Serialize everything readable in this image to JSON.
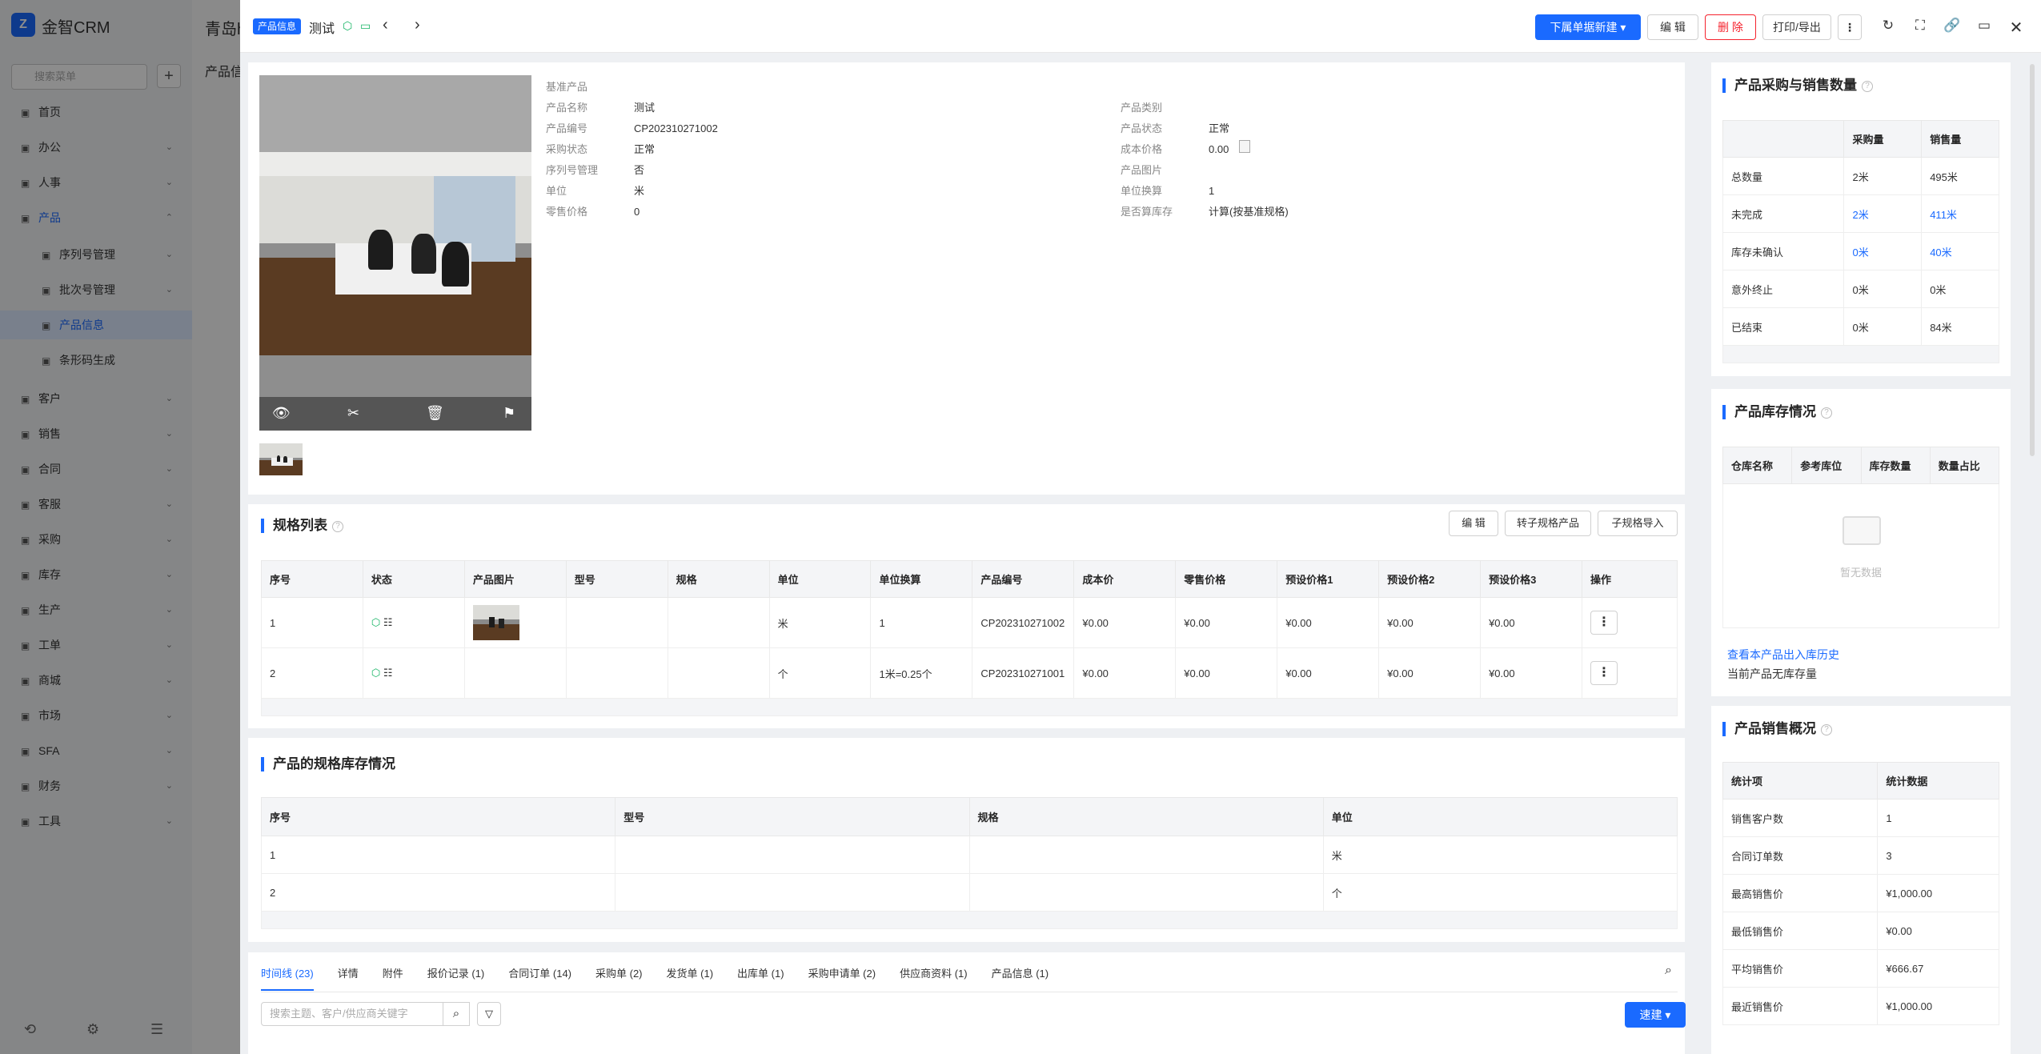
{
  "app": {
    "name": "金智CRM",
    "bg_title": "青岛h",
    "bg_sub": "产品信"
  },
  "sidebar": {
    "search_placeholder": "搜索菜单",
    "items": [
      {
        "label": "首页",
        "icon": "home-icon",
        "sub": false
      },
      {
        "label": "办公",
        "icon": "office-icon",
        "sub": false
      },
      {
        "label": "人事",
        "icon": "user-icon",
        "sub": false
      },
      {
        "label": "产品",
        "icon": "product-icon",
        "sub": false,
        "active": true
      },
      {
        "label": "序列号管理",
        "icon": "serial-icon",
        "sub": true
      },
      {
        "label": "批次号管理",
        "icon": "batch-icon",
        "sub": true
      },
      {
        "label": "产品信息",
        "icon": "product-info-icon",
        "sub": true,
        "active": true
      },
      {
        "label": "条形码生成",
        "icon": "barcode-icon",
        "sub": true
      },
      {
        "label": "客户",
        "icon": "customer-icon",
        "sub": false
      },
      {
        "label": "销售",
        "icon": "sales-icon",
        "sub": false
      },
      {
        "label": "合同",
        "icon": "contract-icon",
        "sub": false
      },
      {
        "label": "客服",
        "icon": "service-icon",
        "sub": false
      },
      {
        "label": "采购",
        "icon": "purchase-icon",
        "sub": false
      },
      {
        "label": "库存",
        "icon": "inventory-icon",
        "sub": false
      },
      {
        "label": "生产",
        "icon": "production-icon",
        "sub": false
      },
      {
        "label": "工单",
        "icon": "workorder-icon",
        "sub": false
      },
      {
        "label": "商城",
        "icon": "mall-icon",
        "sub": false
      },
      {
        "label": "市场",
        "icon": "market-icon",
        "sub": false
      },
      {
        "label": "SFA",
        "icon": "sfa-icon",
        "sub": false
      },
      {
        "label": "财务",
        "icon": "finance-icon",
        "sub": false
      },
      {
        "label": "工具",
        "icon": "tools-icon",
        "sub": false
      }
    ]
  },
  "header": {
    "tag": "产品信息",
    "title": "测试",
    "buttons": {
      "new_child": "下属单据新建",
      "edit": "编 辑",
      "delete": "删 除",
      "print": "打印/导出"
    }
  },
  "product": {
    "base_label": "基准产品",
    "left": [
      {
        "k": "产品名称",
        "v": "测试"
      },
      {
        "k": "产品编号",
        "v": "CP202310271002"
      },
      {
        "k": "采购状态",
        "v": "正常"
      },
      {
        "k": "序列号管理",
        "v": "否"
      },
      {
        "k": "单位",
        "v": "米"
      },
      {
        "k": "零售价格",
        "v": "0"
      }
    ],
    "right": [
      {
        "k": "产品类别",
        "v": ""
      },
      {
        "k": "产品状态",
        "v": "正常"
      },
      {
        "k": "成本价格",
        "v": "0.00"
      },
      {
        "k": "产品图片",
        "v": ""
      },
      {
        "k": "单位换算",
        "v": "1"
      },
      {
        "k": "是否算库存",
        "v": "计算(按基准规格)"
      }
    ]
  },
  "spec": {
    "title": "规格列表",
    "buttons": [
      "编 辑",
      "转子规格产品",
      "子规格导入"
    ],
    "headers": [
      "序号",
      "状态",
      "产品图片",
      "型号",
      "规格",
      "单位",
      "单位换算",
      "产品编号",
      "成本价",
      "零售价格",
      "预设价格1",
      "预设价格2",
      "预设价格3",
      "操作"
    ],
    "rows": [
      {
        "no": "1",
        "unit": "米",
        "conv": "1",
        "code": "CP202310271002",
        "cost": "¥0.00",
        "retail": "¥0.00",
        "p1": "¥0.00",
        "p2": "¥0.00",
        "p3": "¥0.00"
      },
      {
        "no": "2",
        "unit": "个",
        "conv": "1米=0.25个",
        "code": "CP202310271001",
        "cost": "¥0.00",
        "retail": "¥0.00",
        "p1": "¥0.00",
        "p2": "¥0.00",
        "p3": "¥0.00"
      }
    ]
  },
  "spec_stock": {
    "title": "产品的规格库存情况",
    "headers": [
      "序号",
      "型号",
      "规格",
      "单位"
    ],
    "rows": [
      {
        "no": "1",
        "unit": "米"
      },
      {
        "no": "2",
        "unit": "个"
      }
    ]
  },
  "tabs": [
    "时间线 (23)",
    "详情",
    "附件",
    "报价记录 (1)",
    "合同订单 (14)",
    "采购单 (2)",
    "发货单 (1)",
    "出库单 (1)",
    "采购申请单 (2)",
    "供应商资料 (1)",
    "产品信息 (1)"
  ],
  "timeline": {
    "search_placeholder": "搜索主题、客户/供应商关键字",
    "quick_new": "速建"
  },
  "qty_panel": {
    "title": "产品采购与销售数量",
    "headers": [
      "",
      "采购量",
      "销售量"
    ],
    "rows": [
      {
        "label": "总数量",
        "buy": "2米",
        "sell": "495米",
        "link": false
      },
      {
        "label": "未完成",
        "buy": "2米",
        "sell": "411米",
        "link": true
      },
      {
        "label": "库存未确认",
        "buy": "0米",
        "sell": "40米",
        "link": true
      },
      {
        "label": "意外终止",
        "buy": "0米",
        "sell": "0米",
        "link": false
      },
      {
        "label": "已结束",
        "buy": "0米",
        "sell": "84米",
        "link": false
      }
    ]
  },
  "stock_panel": {
    "title": "产品库存情况",
    "headers": [
      "仓库名称",
      "参考库位",
      "库存数量",
      "数量占比"
    ],
    "empty": "暂无数据",
    "history_link": "查看本产品出入库历史",
    "note": "当前产品无库存量"
  },
  "sales_panel": {
    "title": "产品销售概况",
    "headers": [
      "统计项",
      "统计数据"
    ],
    "rows": [
      {
        "k": "销售客户数",
        "v": "1"
      },
      {
        "k": "合同订单数",
        "v": "3"
      },
      {
        "k": "最高销售价",
        "v": "¥1,000.00"
      },
      {
        "k": "最低销售价",
        "v": "¥0.00"
      },
      {
        "k": "平均销售价",
        "v": "¥666.67"
      },
      {
        "k": "最近销售价",
        "v": "¥1,000.00"
      }
    ]
  },
  "colors": {
    "accent": "#1a6aff",
    "danger": "#f5222d",
    "green": "#18b566"
  }
}
